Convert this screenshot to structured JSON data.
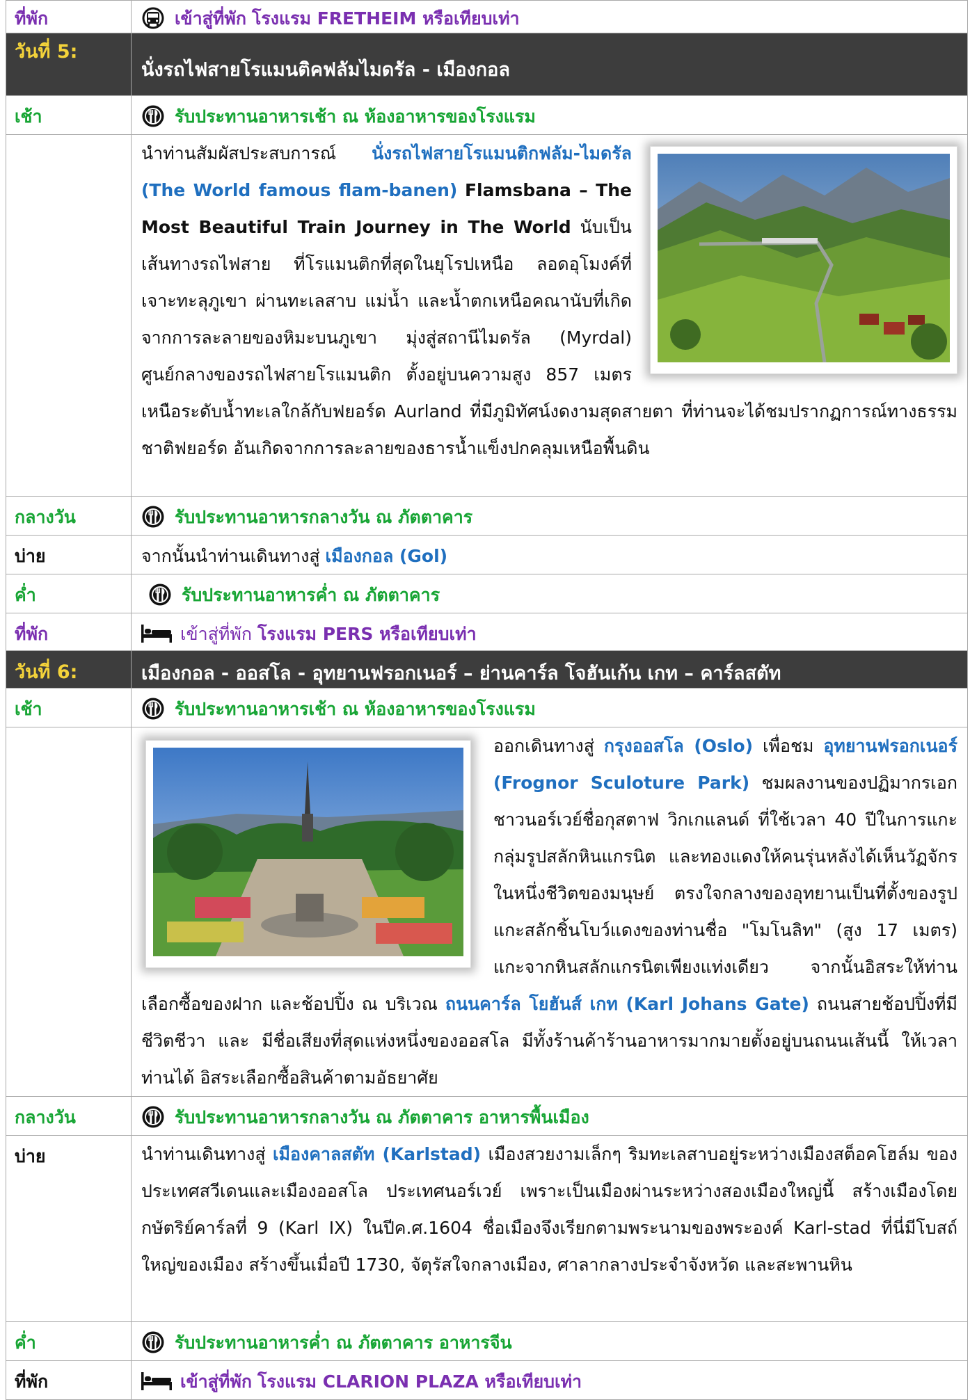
{
  "labels": {
    "lodging": "ที่พัก",
    "morning": "เช้า",
    "noon": "กลางวัน",
    "afternoon": "บ่าย",
    "evening": "ค่ำ"
  },
  "top_lodging": {
    "prefix": "เข้าสู่ที่พัก",
    "text": "โรงแรม FRETHEIM หรือเทียบเท่า"
  },
  "day5": {
    "label_prefix": "วันที่",
    "label_number": "5:",
    "title": "นั่งรถไฟสายโรแมนติคฟลัมไมดรัล - เมืองกอล",
    "breakfast": "รับประทานอาหารเช้า ณ ห้องอาหารของโรงแรม",
    "desc_1": "นำท่านสัมผัสประสบการณ์",
    "desc_2": "นั่งรถไฟสายโรแมนติกฟลัม-ไมดรัล (The World famous flam-banen)",
    "desc_3": "Flamsbana – The Most Beautiful Train Journey in The World",
    "desc_4": "นับเป็นเส้นทางรถไฟสาย ที่โรแมนติกที่สุดในยุโรปเหนือ ลอดอุโมงค์ที่เจาะทะลุภูเขา ผ่านทะเลสาบ แม่น้ำ และน้ำตกเหนือคณานับที่เกิดจากการละลายของหิมะบนภูเขา มุ่งสู่สถานีไมดรัล (Myrdal) ศูนย์กลางของรถไฟสายโรแมนติก ตั้งอยู่บนความสูง 857 เมตร เหนือระดับน้ำทะเลใกล้กับฟยอร์ด Aurland ที่มีภูมิทัศน์งดงามสุดสายตา ที่ท่านจะได้ชมปรากฏการณ์ทางธรรมชาติฟยอร์ด อันเกิดจากการละลายของธารน้ำแข็งปกคลุมเหนือพื้นดิน",
    "lunch": "รับประทานอาหารกลางวัน ณ ภัตตาคาร",
    "afternoon_prefix": "จากนั้นนำท่านเดินทางสู่",
    "afternoon_place": "เมืองกอล (Gol)",
    "dinner": "รับประทานอาหารค่ำ ณ ภัตตาคาร",
    "lodging_prefix": "เข้าสู่ที่พัก",
    "lodging_text": "โรงแรม  PERS หรือเทียบเท่า"
  },
  "day6": {
    "label_prefix": "วันที่",
    "label_number": "6:",
    "title": "เมืองกอล - ออสโล - อุทยานฟรอกเนอร์ – ย่านคาร์ล โจฮันเก้น เกท – คาร์ลสตัท",
    "breakfast": "รับประทานอาหารเช้า ณ ห้องอาหารของโรงแรม",
    "desc_1": "ออกเดินทางสู่",
    "desc_2": "กรุงออสโล (Oslo)",
    "desc_3": "เพื่อชม",
    "desc_4": "อุทยานฟรอกเนอร์ (Frognor Sculoture Park)",
    "desc_5": "ชมผลงานของปฏิมากรเอกชาวนอร์เวย์ชื่อกุสตาฟ วิกเกแลนด์ ที่ใช้เวลา 40 ปีในการแกะกลุ่มรูปสลักหินแกรนิต และทองแดงให้คนรุ่นหลังได้เห็นวัฏจักรในหนึ่งชีวิตของมนุษย์ ตรงใจกลางของอุทยานเป็นที่ตั้งของรูปแกะสลักชิ้นโบว์แดงของท่านชื่อ \"โมโนลิท\" (สูง 17 เมตร) แกะจากหินสลักแกรนิตเพียงแท่งเดียว จากนั้นอิสระให้ท่านเลือกซื้อของฝาก และช้อปปิ้ง ณ บริเวณ",
    "desc_6": "ถนนคาร์ล โยฮันส์ เกท (Karl Johans Gate)",
    "desc_7": "ถนนสายช้อปปิ้งที่มีชีวิตชีวา และ มีชื่อเสียงที่สุดแห่งหนึ่งของออสโล มีทั้งร้านค้าร้านอาหารมากมายตั้งอยู่บนถนนเส้นนี้ ให้เวลาท่านได้ อิสระเลือกซื้อสินค้าตามอัธยาศัย",
    "lunch": "รับประทานอาหารกลางวัน ณ ภัตตาคาร อาหารพื้นเมือง",
    "afternoon_prefix": "นำท่านเดินทางสู่",
    "afternoon_place": "เมืองคาลสตัท (Karlstad)",
    "afternoon_text": "เมืองสวยงามเล็กๆ ริมทะเลสาบอยู่ระหว่างเมืองสต็อคโฮล์ม ของประเทศสวีเดนและเมืองออสโล ประเทศนอร์เวย์ เพราะเป็นเมืองผ่านระหว่างสองเมืองใหญ่นี้ สร้างเมืองโดยกษัตริย์คาร์ลที่ 9 (Karl IX) ในปีค.ศ.1604 ชื่อเมืองจึงเรียกตามพระนามของพระองค์ Karl-stad ที่นี่มีโบสถ์ใหญ่ของเมือง สร้างขึ้นเมื่อปี 1730, จัตุรัสใจกลางเมือง, ศาลากลางประจำจังหวัด และสะพานหิน",
    "dinner": "รับประทานอาหารค่ำ ณ ภัตตาคาร อาหารจีน",
    "lodging_prefix": "เข้าสู่ที่พัก",
    "lodging_text": "โรงแรม CLARION PLAZA  หรือเทียบเท่า"
  },
  "icons": {
    "meal": "fork-knife-icon",
    "bed": "bed-icon",
    "bus": "bus-icon"
  },
  "colors": {
    "green_label": "#17a534",
    "purple_label": "#7a2fb0",
    "blue_link": "#1f6fbf",
    "day_header_bg": "#3d3d3d",
    "day_number": "#f4d33a"
  }
}
